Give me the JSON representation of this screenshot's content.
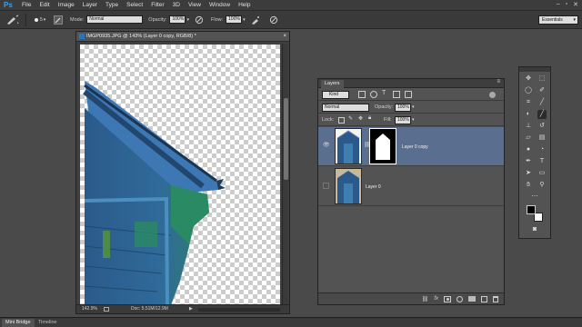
{
  "app": {
    "logo": "Ps"
  },
  "menu": [
    "File",
    "Edit",
    "Image",
    "Layer",
    "Type",
    "Select",
    "Filter",
    "3D",
    "View",
    "Window",
    "Help"
  ],
  "window_controls": {
    "minimize": "–",
    "restore": "▫",
    "close": "✕"
  },
  "options_bar": {
    "brush_size": "5",
    "mode_label": "Mode:",
    "mode_value": "Normal",
    "opacity_label": "Opacity:",
    "opacity_value": "100%",
    "flow_label": "Flow:",
    "flow_value": "100%"
  },
  "workspace": "Essentials",
  "document": {
    "tab_title": "IMGP0935.JPG @ 143% (Layer 0 copy, RGB/8) *",
    "close_glyph": "×",
    "zoom": "142.9%",
    "doc_info": "Doc: 5.51M/12.9M"
  },
  "layers_panel": {
    "tab": "Layers",
    "filter_kind": "Kind",
    "blend_mode": "Normal",
    "opacity_label": "Opacity:",
    "opacity_value": "100%",
    "lock_label": "Lock:",
    "fill_label": "Fill:",
    "fill_value": "100%",
    "layers": [
      {
        "name": "Layer 0 copy",
        "visible": true,
        "selected": true,
        "has_mask": true
      },
      {
        "name": "Layer 0",
        "visible": false,
        "selected": false,
        "has_mask": false
      }
    ],
    "footer_icons": [
      "link-icon",
      "fx-icon",
      "mask-icon",
      "adjustment-icon",
      "group-icon",
      "new-layer-icon",
      "trash-icon"
    ]
  },
  "bottom_tabs": [
    "Mini Bridge",
    "Timeline"
  ],
  "colors": {
    "selected_layer": "#5a6f90",
    "accent": "#2fa3ff"
  }
}
